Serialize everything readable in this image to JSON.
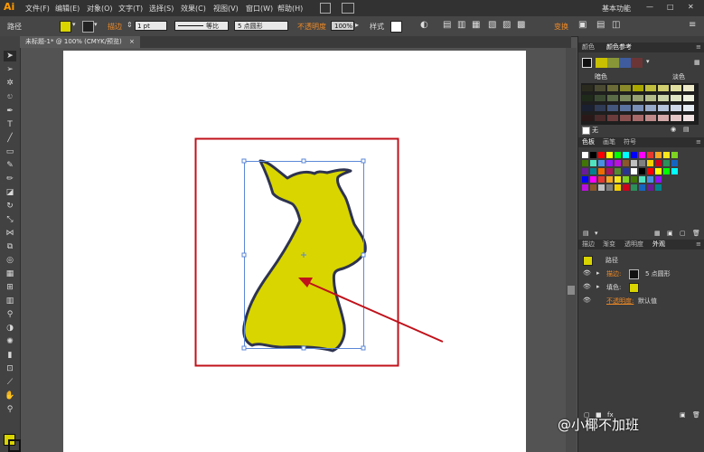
{
  "app": {
    "logo": "Ai",
    "workspace": "基本功能",
    "menus": [
      "文件(F)",
      "编辑(E)",
      "对象(O)",
      "文字(T)",
      "选择(S)",
      "效果(C)",
      "视图(V)",
      "窗口(W)",
      "帮助(H)"
    ],
    "window_controls": [
      "—",
      "□",
      "✕"
    ]
  },
  "control_bar": {
    "object_type": "路径",
    "stroke_label": "描边",
    "stroke_weight": "1 pt",
    "stroke_profile": "等比",
    "brush_def": "5 点圆形",
    "opacity_label": "不透明度",
    "opacity_value": "100%",
    "style_label": "样式",
    "align_label": "变换",
    "fill_color": "#d9d400",
    "stroke_color": "#000000"
  },
  "document": {
    "tab_title": "未标题-1* @ 100% (CMYK/预览)",
    "tab_close": "×"
  },
  "panels": {
    "color": {
      "tabs": [
        "颜色",
        "颜色参考"
      ],
      "row1": [
        "暗色",
        "淡色"
      ],
      "none_label": "无",
      "harmony": [
        "#c8c000",
        "#889638",
        "#3e5c9e",
        "#6b3535"
      ],
      "grid_colors": [
        [
          "#2a2a1e",
          "#4a4a33",
          "#6b6b38",
          "#8a8a2a",
          "#aaa800",
          "#c0be3c",
          "#d0ce6e",
          "#e0dfa0",
          "#eceac8"
        ],
        [
          "#1f2a1a",
          "#3a4a32",
          "#5a6b48",
          "#7c8a5e",
          "#98a272",
          "#b4bc8c",
          "#cad2a8",
          "#dee4c4",
          "#eef1de"
        ],
        [
          "#1a2030",
          "#2f3a55",
          "#44567c",
          "#5a72a0",
          "#7a90b8",
          "#98aacb",
          "#b4c2db",
          "#cfd8e8",
          "#e6ecf4"
        ],
        [
          "#2a1818",
          "#4a2a2a",
          "#6b3c3c",
          "#8a5050",
          "#a86a6a",
          "#c08a8a",
          "#d4a8a8",
          "#e4c6c6",
          "#f2e2e2"
        ]
      ]
    },
    "swatches": {
      "tabs": [
        "色板",
        "画笔",
        "符号"
      ]
    },
    "appearance": {
      "tabs": [
        "描边",
        "渐变",
        "透明度",
        "外观"
      ],
      "title": "路径",
      "rows": [
        {
          "label": "描边:",
          "value": "5 点圆形"
        },
        {
          "label": "填色:",
          "value": ""
        },
        {
          "label": "不透明度:",
          "value": "默认值"
        }
      ]
    }
  },
  "watermark": "@小椰不加班"
}
